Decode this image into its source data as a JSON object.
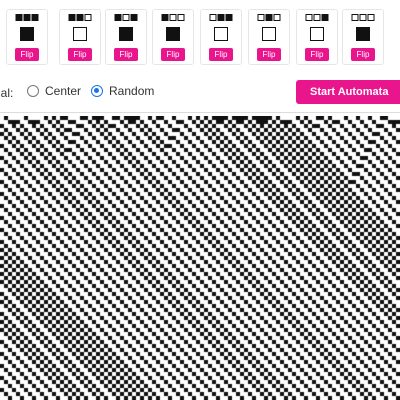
{
  "rules": [
    {
      "pattern": [
        1,
        1,
        1
      ],
      "output": 1,
      "flip_label": "Flip"
    },
    {
      "pattern": [
        1,
        1,
        0
      ],
      "output": 0,
      "flip_label": "Flip"
    },
    {
      "pattern": [
        1,
        0,
        1
      ],
      "output": 1,
      "flip_label": "Flip"
    },
    {
      "pattern": [
        1,
        0,
        0
      ],
      "output": 1,
      "flip_label": "Flip"
    },
    {
      "pattern": [
        0,
        1,
        1
      ],
      "output": 0,
      "flip_label": "Flip"
    },
    {
      "pattern": [
        0,
        1,
        0
      ],
      "output": 0,
      "flip_label": "Flip"
    },
    {
      "pattern": [
        0,
        0,
        1
      ],
      "output": 0,
      "flip_label": "Flip"
    },
    {
      "pattern": [
        0,
        0,
        0
      ],
      "output": 1,
      "flip_label": "Flip"
    }
  ],
  "controls": {
    "initial_label": "ial:",
    "options": [
      {
        "label": "Center",
        "checked": false
      },
      {
        "label": "Random",
        "checked": true
      }
    ],
    "start_label": "Start Automata"
  },
  "colors": {
    "accent": "#e8158c",
    "radio": "#1a73e8",
    "cell_on": "#111111",
    "cell_off": "#ffffff"
  }
}
